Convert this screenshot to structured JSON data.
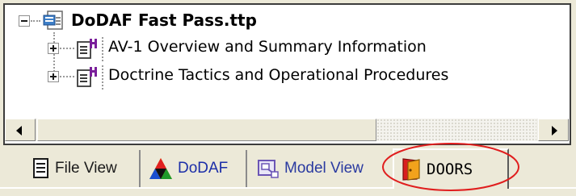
{
  "tree": {
    "root": {
      "label": "DoDAF Fast Pass.ttp",
      "expander": "minus",
      "icon": "project-file-icon"
    },
    "children": [
      {
        "label": "AV-1 Overview and Summary Information",
        "expander": "plus",
        "icon": "document-package-icon"
      },
      {
        "label": "Doctrine Tactics and Operational Procedures",
        "expander": "plus",
        "icon": "document-package-icon"
      }
    ]
  },
  "scrollbar": {
    "left_arrow": "scroll-left-icon",
    "right_arrow": "scroll-right-icon"
  },
  "tabs": [
    {
      "label": "File View",
      "icon": "file-view-icon",
      "active": false,
      "text_color": "#1a1a1a"
    },
    {
      "label": "DoDAF",
      "icon": "dodaf-icon",
      "active": false,
      "text_color": "#1c2ea8"
    },
    {
      "label": "Model View",
      "icon": "model-view-icon",
      "active": false,
      "text_color": "#2a3aa0"
    },
    {
      "label": "DOORS",
      "icon": "doors-icon",
      "active": true,
      "text_color": "#000000"
    }
  ],
  "colors": {
    "window_bg": "#ece9d8",
    "tree_bg": "#ffffff",
    "annotation": "#e01e1e",
    "package_accent": "#7a1f9a"
  }
}
